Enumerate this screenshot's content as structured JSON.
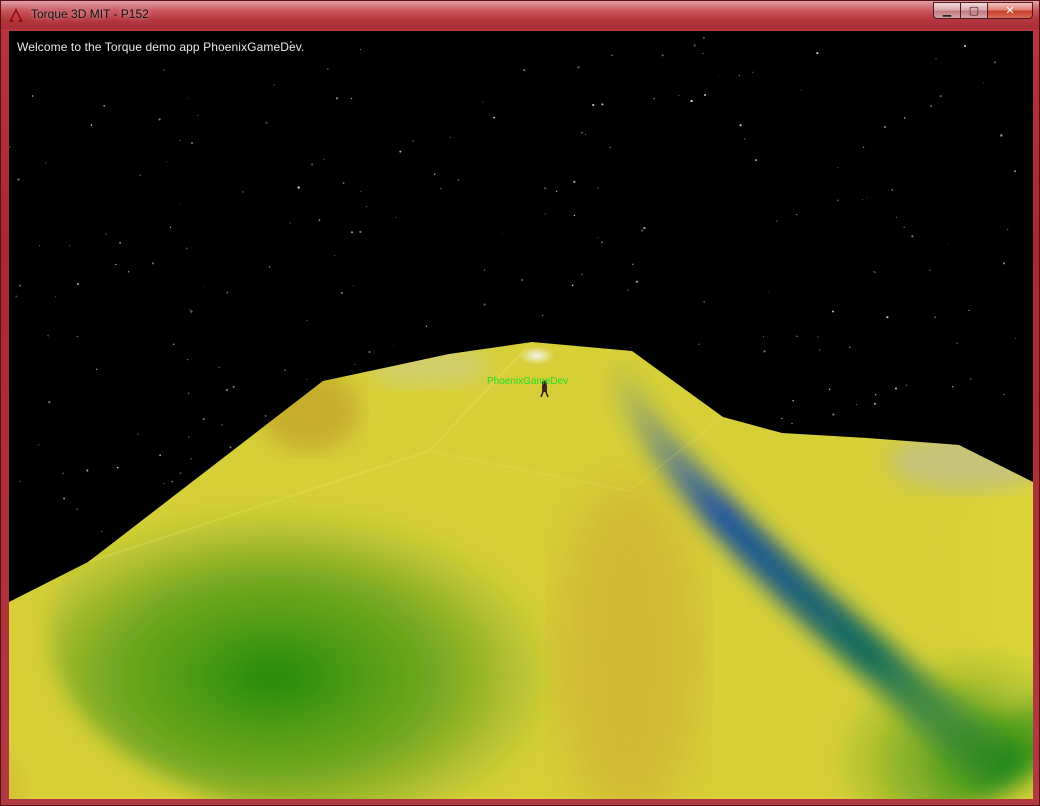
{
  "window": {
    "title": "Torque 3D MIT - P152",
    "controls": {
      "minimize": "▁",
      "maximize": "▢",
      "close": "✕"
    }
  },
  "hud": {
    "welcome_message": "Welcome to the Torque demo app PhoenixGameDev."
  },
  "scene": {
    "player_name": "PhoenixGameDev",
    "sky_color": "#000000",
    "terrain_colors": [
      "#d8d23a",
      "#2e8f10",
      "#1d5fa8",
      "#c9a82a",
      "#e8e4d0"
    ]
  }
}
